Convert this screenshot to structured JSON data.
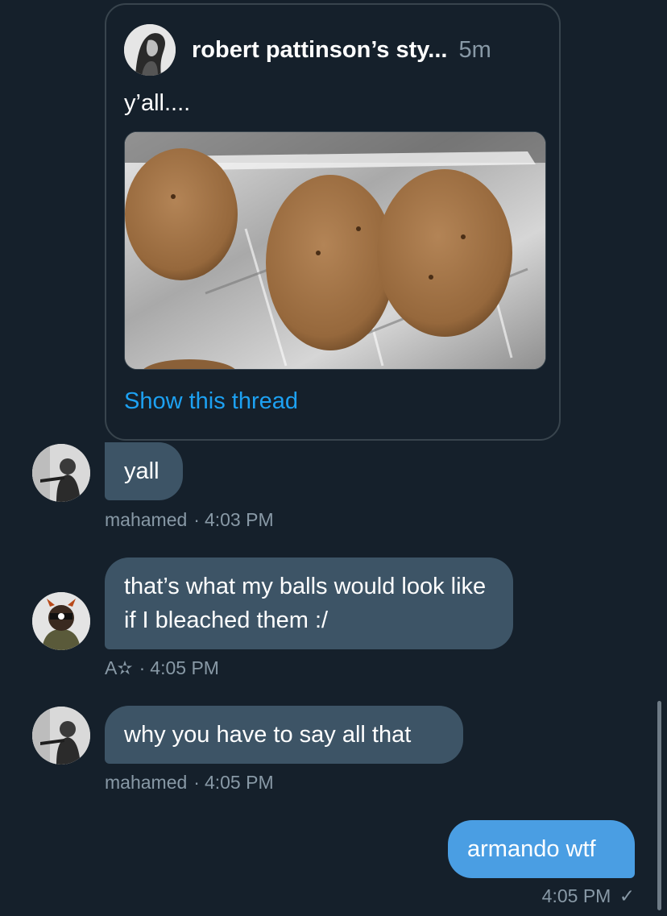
{
  "quoted_tweet": {
    "author": "robert pattinson’s sty...",
    "time": "5m",
    "text": "y’all....",
    "link_label": "Show this thread"
  },
  "messages": [
    {
      "text": "yall",
      "sender": "mahamed",
      "time": "4:03 PM"
    },
    {
      "text": "that’s what my balls would look like if I bleached them :/",
      "sender": "A✫",
      "time": "4:05 PM"
    },
    {
      "text": "why you have to say all that",
      "sender": "mahamed",
      "time": "4:05 PM"
    },
    {
      "text": "armando wtf",
      "time": "4:05 PM",
      "status_icon": "check-icon"
    }
  ],
  "colors": {
    "background": "#15202b",
    "incoming_bubble": "#3d5466",
    "outgoing_bubble": "#4a9ee3",
    "link": "#1da1f2",
    "meta_text": "#8899a6",
    "card_border": "#38444d"
  }
}
